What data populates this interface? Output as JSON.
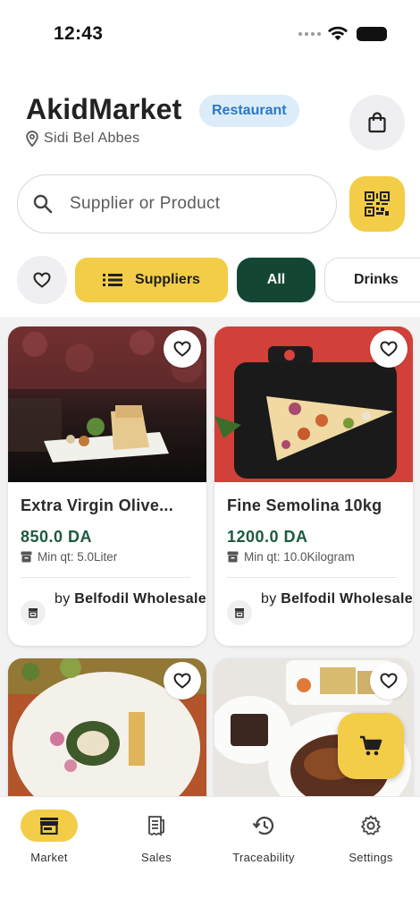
{
  "status_bar": {
    "time": "12:43"
  },
  "header": {
    "app_name": "AkidMarket",
    "badge": "Restaurant",
    "location": "Sidi Bel Abbes"
  },
  "search": {
    "placeholder": "Supplier or Product"
  },
  "filters": {
    "suppliers_label": "Suppliers",
    "chips": [
      "All",
      "Drinks"
    ]
  },
  "products": [
    {
      "name": "Extra Virgin Olive...",
      "price": "850.0 DA",
      "min_qt": "Min qt: 5.0Liter",
      "by": "by",
      "supplier": "Belfodil Wholesale"
    },
    {
      "name": "Fine Semolina 10kg",
      "price": "1200.0 DA",
      "min_qt": "Min qt: 10.0Kilogram",
      "by": "by",
      "supplier": "Belfodil Wholesale"
    }
  ],
  "bottom_nav": [
    {
      "label": "Market",
      "icon": "store-icon",
      "active": true
    },
    {
      "label": "Sales",
      "icon": "receipt-icon",
      "active": false
    },
    {
      "label": "Traceability",
      "icon": "history-icon",
      "active": false
    },
    {
      "label": "Settings",
      "icon": "gear-icon",
      "active": false
    }
  ],
  "colors": {
    "accent_yellow": "#f3cd47",
    "dark_green": "#134734",
    "price_green": "#1d5a3e",
    "badge_bg": "#dcecf9",
    "badge_text": "#2a78c6"
  }
}
